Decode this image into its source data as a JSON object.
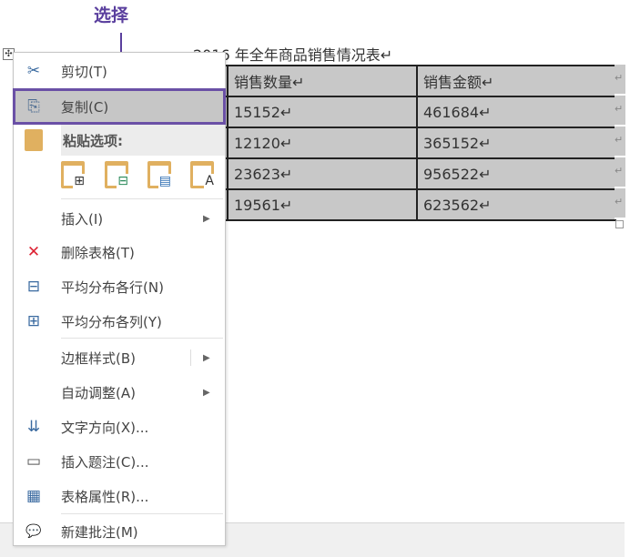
{
  "annotation": {
    "label": "选择",
    "color": "#5a3f9e"
  },
  "document": {
    "title": "2016 年全年商品销售情况表↵",
    "table": {
      "headers": [
        "",
        "销售数量↵",
        "销售金额↵"
      ],
      "rows": [
        [
          "",
          "15152↵",
          "461684↵"
        ],
        [
          "",
          "12120↵",
          "365152↵"
        ],
        [
          "",
          "23623↵",
          "956522↵"
        ],
        [
          "",
          "19561↵",
          "623562↵"
        ]
      ]
    },
    "row_marks": [
      "↵",
      "↵",
      "↵",
      "↵",
      "↵"
    ],
    "move_handle": "✣"
  },
  "menu": {
    "cut": {
      "icon": "scissors-icon",
      "glyph": "✂",
      "label": "剪切(T)"
    },
    "copy": {
      "icon": "copy-icon",
      "glyph": "⎘",
      "label": "复制(C)"
    },
    "paste_header": {
      "icon": "clipboard-icon",
      "label": "粘贴选项:"
    },
    "paste_options": [
      {
        "icon": "paste-nested-table-icon",
        "glyph": "⊞"
      },
      {
        "icon": "paste-merge-table-icon",
        "glyph": "⊟"
      },
      {
        "icon": "paste-insert-rows-icon",
        "glyph": "▤"
      },
      {
        "icon": "paste-text-only-icon",
        "glyph": "A"
      }
    ],
    "items": [
      {
        "icon": "",
        "glyph": "",
        "label": "插入(I)",
        "arrow": "▶"
      },
      {
        "icon": "delete-table-icon",
        "glyph": "✕",
        "label": "删除表格(T)"
      },
      {
        "icon": "distribute-rows-icon",
        "glyph": "⊟",
        "label": "平均分布各行(N)"
      },
      {
        "icon": "distribute-columns-icon",
        "glyph": "⊞",
        "label": "平均分布各列(Y)"
      },
      {
        "icon": "",
        "glyph": "",
        "label": "边框样式(B)",
        "arrow": "▶"
      },
      {
        "icon": "",
        "glyph": "",
        "label": "自动调整(A)",
        "arrow": "▶"
      },
      {
        "icon": "text-direction-icon",
        "glyph": "⇊",
        "label": "文字方向(X)..."
      },
      {
        "icon": "insert-caption-icon",
        "glyph": "▭",
        "label": "插入题注(C)..."
      },
      {
        "icon": "table-properties-icon",
        "glyph": "▦",
        "label": "表格属性(R)..."
      },
      {
        "icon": "new-comment-icon",
        "glyph": "💬",
        "label": "新建批注(M)"
      }
    ]
  }
}
